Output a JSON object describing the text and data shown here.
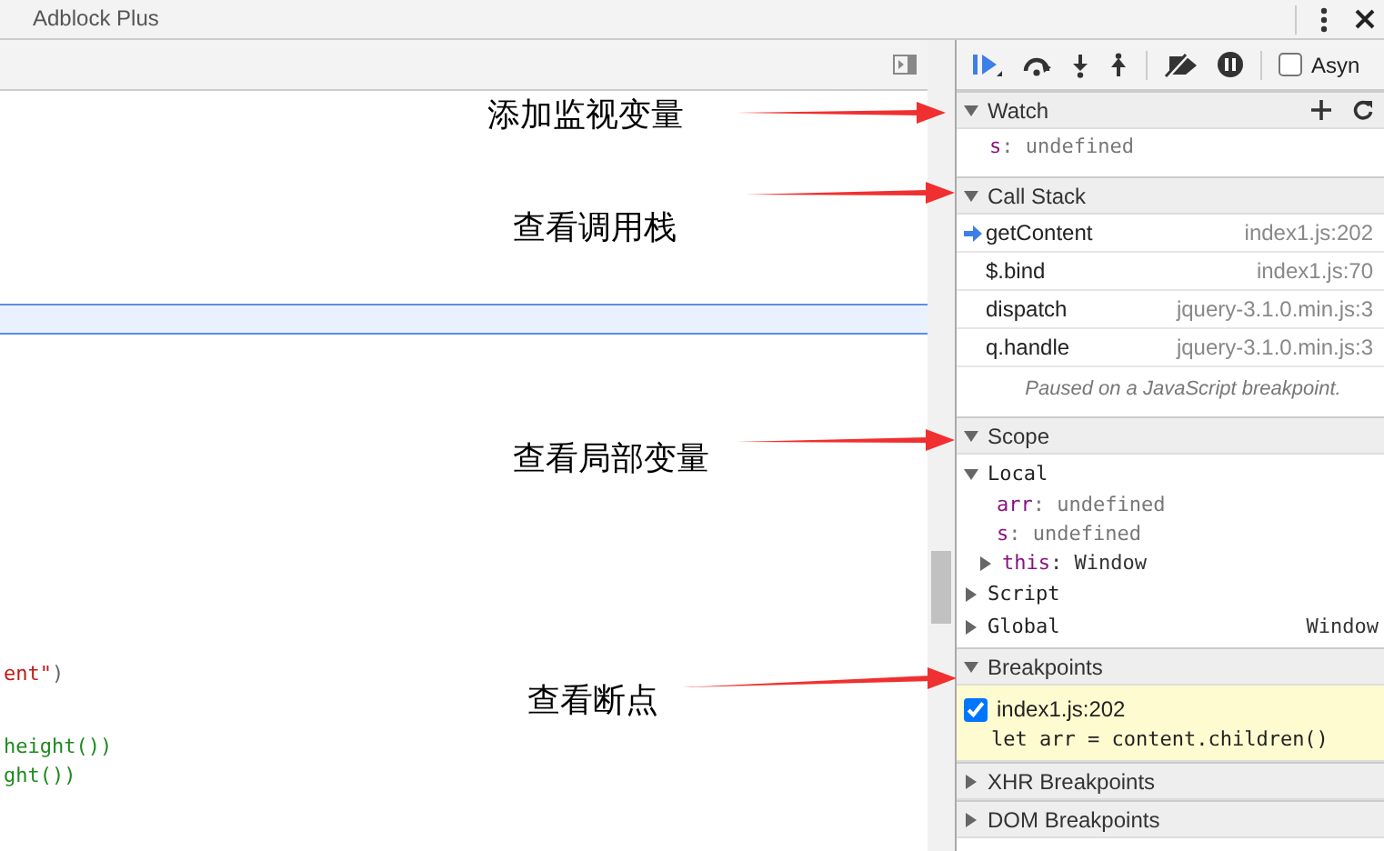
{
  "window": {
    "title": "Adblock Plus"
  },
  "editor": {
    "code_lines": [
      {
        "tokens": [
          {
            "text": "ent\"",
            "kind": "string"
          },
          {
            "text": ")",
            "kind": "punct"
          }
        ]
      },
      {
        "tokens": [
          {
            "text": "height",
            "kind": "func"
          },
          {
            "text": "())",
            "kind": "func"
          }
        ]
      },
      {
        "tokens": [
          {
            "text": "ght",
            "kind": "func"
          },
          {
            "text": "())",
            "kind": "func"
          }
        ]
      }
    ]
  },
  "annotations": [
    {
      "text": "添加监视变量"
    },
    {
      "text": "查看调用栈"
    },
    {
      "text": "查看局部变量"
    },
    {
      "text": "查看断点"
    }
  ],
  "debugger_toolbar": {
    "async_label": "Asyn",
    "async_checked": false
  },
  "watch": {
    "title": "Watch",
    "expanded": true,
    "items": [
      {
        "name": "s",
        "value": ": undefined"
      }
    ]
  },
  "call_stack": {
    "title": "Call Stack",
    "expanded": true,
    "frames": [
      {
        "name": "getContent",
        "location": "index1.js:202",
        "current": true
      },
      {
        "name": "$.bind",
        "location": "index1.js:70",
        "current": false
      },
      {
        "name": "dispatch",
        "location": "jquery-3.1.0.min.js:3",
        "current": false
      },
      {
        "name": "q.handle",
        "location": "jquery-3.1.0.min.js:3",
        "current": false
      }
    ],
    "message": "Paused on a JavaScript breakpoint."
  },
  "scope": {
    "title": "Scope",
    "expanded": true,
    "groups": [
      {
        "name": "Local",
        "expanded": true,
        "children": [
          {
            "name": "arr",
            "value": ": undefined"
          },
          {
            "name": "s",
            "value": ": undefined"
          },
          {
            "name": "this",
            "value": ": Window",
            "expanded": false
          }
        ]
      },
      {
        "name": "Script",
        "expanded": false
      },
      {
        "name": "Global",
        "value": "Window",
        "expanded": false
      }
    ]
  },
  "breakpoints": {
    "title": "Breakpoints",
    "expanded": true,
    "items": [
      {
        "file": "index1.js:202",
        "code": "let arr = content.children()",
        "checked": true
      }
    ]
  },
  "other_sections": [
    {
      "title": "XHR Breakpoints",
      "expanded": false
    },
    {
      "title": "DOM Breakpoints",
      "expanded": false
    }
  ]
}
